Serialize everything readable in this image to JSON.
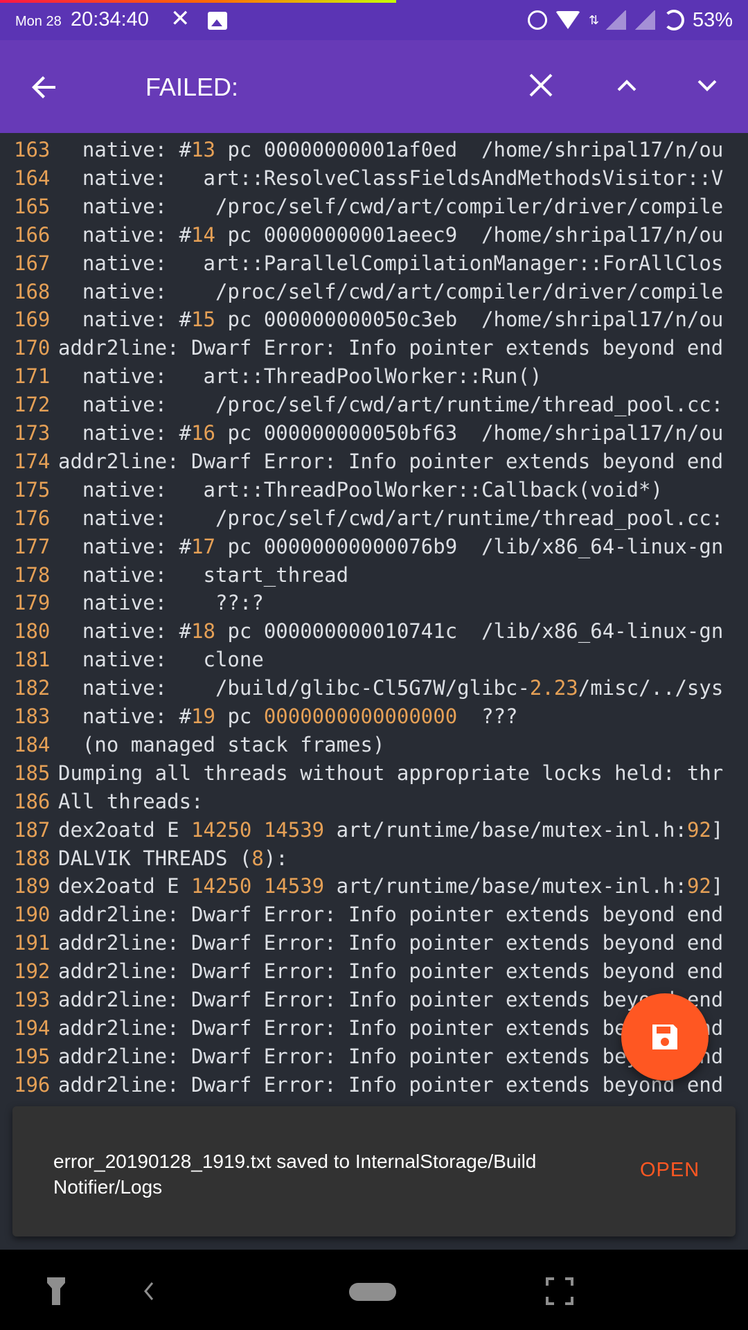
{
  "status_bar": {
    "date": "Mon 28",
    "time": "20:34:40",
    "battery": "53%"
  },
  "toolbar": {
    "title": "FAILED:"
  },
  "log_lines": [
    {
      "n": "163",
      "text": "  native: #13 pc 00000000001af0ed  /home/shripal17/n/ou"
    },
    {
      "n": "164",
      "text": "  native:   art::ResolveClassFieldsAndMethodsVisitor::V"
    },
    {
      "n": "165",
      "text": "  native:    /proc/self/cwd/art/compiler/driver/compile"
    },
    {
      "n": "166",
      "text": "  native: #14 pc 00000000001aeec9  /home/shripal17/n/ou"
    },
    {
      "n": "167",
      "text": "  native:   art::ParallelCompilationManager::ForAllClos"
    },
    {
      "n": "168",
      "text": "  native:    /proc/self/cwd/art/compiler/driver/compile"
    },
    {
      "n": "169",
      "text": "  native: #15 pc 000000000050c3eb  /home/shripal17/n/ou"
    },
    {
      "n": "170",
      "text": "addr2line: Dwarf Error: Info pointer extends beyond end"
    },
    {
      "n": "171",
      "text": "  native:   art::ThreadPoolWorker::Run()"
    },
    {
      "n": "172",
      "text": "  native:    /proc/self/cwd/art/runtime/thread_pool.cc:"
    },
    {
      "n": "173",
      "text": "  native: #16 pc 000000000050bf63  /home/shripal17/n/ou"
    },
    {
      "n": "174",
      "text": "addr2line: Dwarf Error: Info pointer extends beyond end"
    },
    {
      "n": "175",
      "text": "  native:   art::ThreadPoolWorker::Callback(void*)"
    },
    {
      "n": "176",
      "text": "  native:    /proc/self/cwd/art/runtime/thread_pool.cc:"
    },
    {
      "n": "177",
      "text": "  native: #17 pc 00000000000076b9  /lib/x86_64-linux-gn"
    },
    {
      "n": "178",
      "text": "  native:   start_thread"
    },
    {
      "n": "179",
      "text": "  native:    ??:?"
    },
    {
      "n": "180",
      "text": "  native: #18 pc 000000000010741c  /lib/x86_64-linux-gn"
    },
    {
      "n": "181",
      "text": "  native:   clone"
    },
    {
      "n": "182",
      "text": "  native:    /build/glibc-Cl5G7W/glibc-2.23/misc/../sys"
    },
    {
      "n": "183",
      "text": "  native: #19 pc 0000000000000000  ???"
    },
    {
      "n": "184",
      "text": "  (no managed stack frames)"
    },
    {
      "n": "185",
      "text": "Dumping all threads without appropriate locks held: thr"
    },
    {
      "n": "186",
      "text": "All threads:"
    },
    {
      "n": "187",
      "text": "dex2oatd E 14250 14539 art/runtime/base/mutex-inl.h:92]"
    },
    {
      "n": "188",
      "text": "DALVIK THREADS (8):"
    },
    {
      "n": "189",
      "text": "dex2oatd E 14250 14539 art/runtime/base/mutex-inl.h:92]"
    },
    {
      "n": "190",
      "text": "addr2line: Dwarf Error: Info pointer extends beyond end"
    },
    {
      "n": "191",
      "text": "addr2line: Dwarf Error: Info pointer extends beyond end"
    },
    {
      "n": "192",
      "text": "addr2line: Dwarf Error: Info pointer extends beyond end"
    },
    {
      "n": "193",
      "text": "addr2line: Dwarf Error: Info pointer extends beyond end"
    },
    {
      "n": "194",
      "text": "addr2line: Dwarf Error: Info pointer extends beyond end"
    },
    {
      "n": "195",
      "text": "addr2line: Dwarf Error: Info pointer extends beyond end"
    },
    {
      "n": "196",
      "text": "addr2line: Dwarf Error: Info pointer extends beyond end"
    }
  ],
  "fab": {
    "icon": "save-icon",
    "color": "#ff5722"
  },
  "snackbar": {
    "message": "error_20190128_1919.txt saved to InternalStorage/Build Notifier/Logs",
    "action": "OPEN"
  },
  "colors": {
    "toolbar": "#673ab7",
    "status_bar": "#5b34b4",
    "log_background": "#282c34",
    "line_number": "#e5a056",
    "accent": "#ff5722"
  }
}
